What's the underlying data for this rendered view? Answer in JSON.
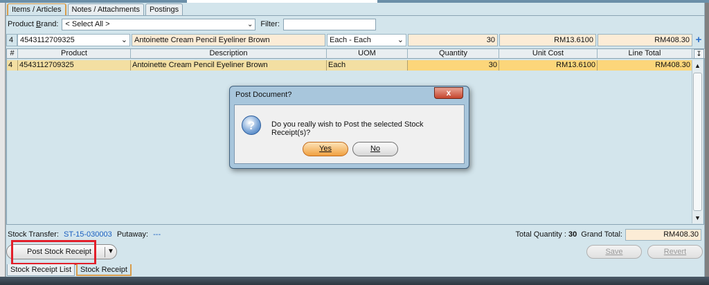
{
  "tabs_top": [
    "Items / Articles",
    "Notes / Attachments",
    "Postings"
  ],
  "filter": {
    "brand_label_pre": "Product ",
    "brand_label_u": "B",
    "brand_label_post": "rand:",
    "brand_value": "< Select All >",
    "filter_label": "Filter:",
    "filter_value": ""
  },
  "entry": {
    "row_num": "4",
    "product": "4543112709325",
    "description": "Antoinette Cream Pencil Eyeliner Brown",
    "uom": "Each - Each",
    "quantity": "30",
    "unit_cost": "RM13.6100",
    "line_total": "RM408.30"
  },
  "grid": {
    "headers": [
      "#",
      "Product",
      "Description",
      "UOM",
      "Quantity",
      "Unit Cost",
      "Line Total"
    ],
    "rows": [
      {
        "num": "4",
        "product": "4543112709325",
        "description": "Antoinette Cream Pencil Eyeliner Brown",
        "uom": "Each",
        "quantity": "30",
        "unit_cost": "RM13.6100",
        "line_total": "RM408.30"
      }
    ]
  },
  "dialog": {
    "title": "Post Document?",
    "close_label": "x",
    "message": "Do you really wish to Post the selected Stock Receipt(s)?",
    "yes_label": "Yes",
    "no_label": "No"
  },
  "footer": {
    "stock_transfer_label": "Stock Transfer:",
    "stock_transfer_value": "ST-15-030003",
    "putaway_label": "Putaway:",
    "putaway_value": "---",
    "total_qty_label": "Total Quantity :",
    "total_qty_value": "30",
    "grand_total_label": "Grand Total:",
    "grand_total_value": "RM408.30"
  },
  "actions": {
    "post_label": "Post Stock Receipt",
    "save_label": "Save",
    "revert_label": "Revert"
  },
  "tabs_bottom": [
    "Stock Receipt List",
    "Stock Receipt"
  ],
  "colors": {
    "accent_orange": "#f0a040",
    "highlight_red": "#e21f2a",
    "link_blue": "#1a5fc0",
    "row_selected": "#f3dfa2"
  }
}
